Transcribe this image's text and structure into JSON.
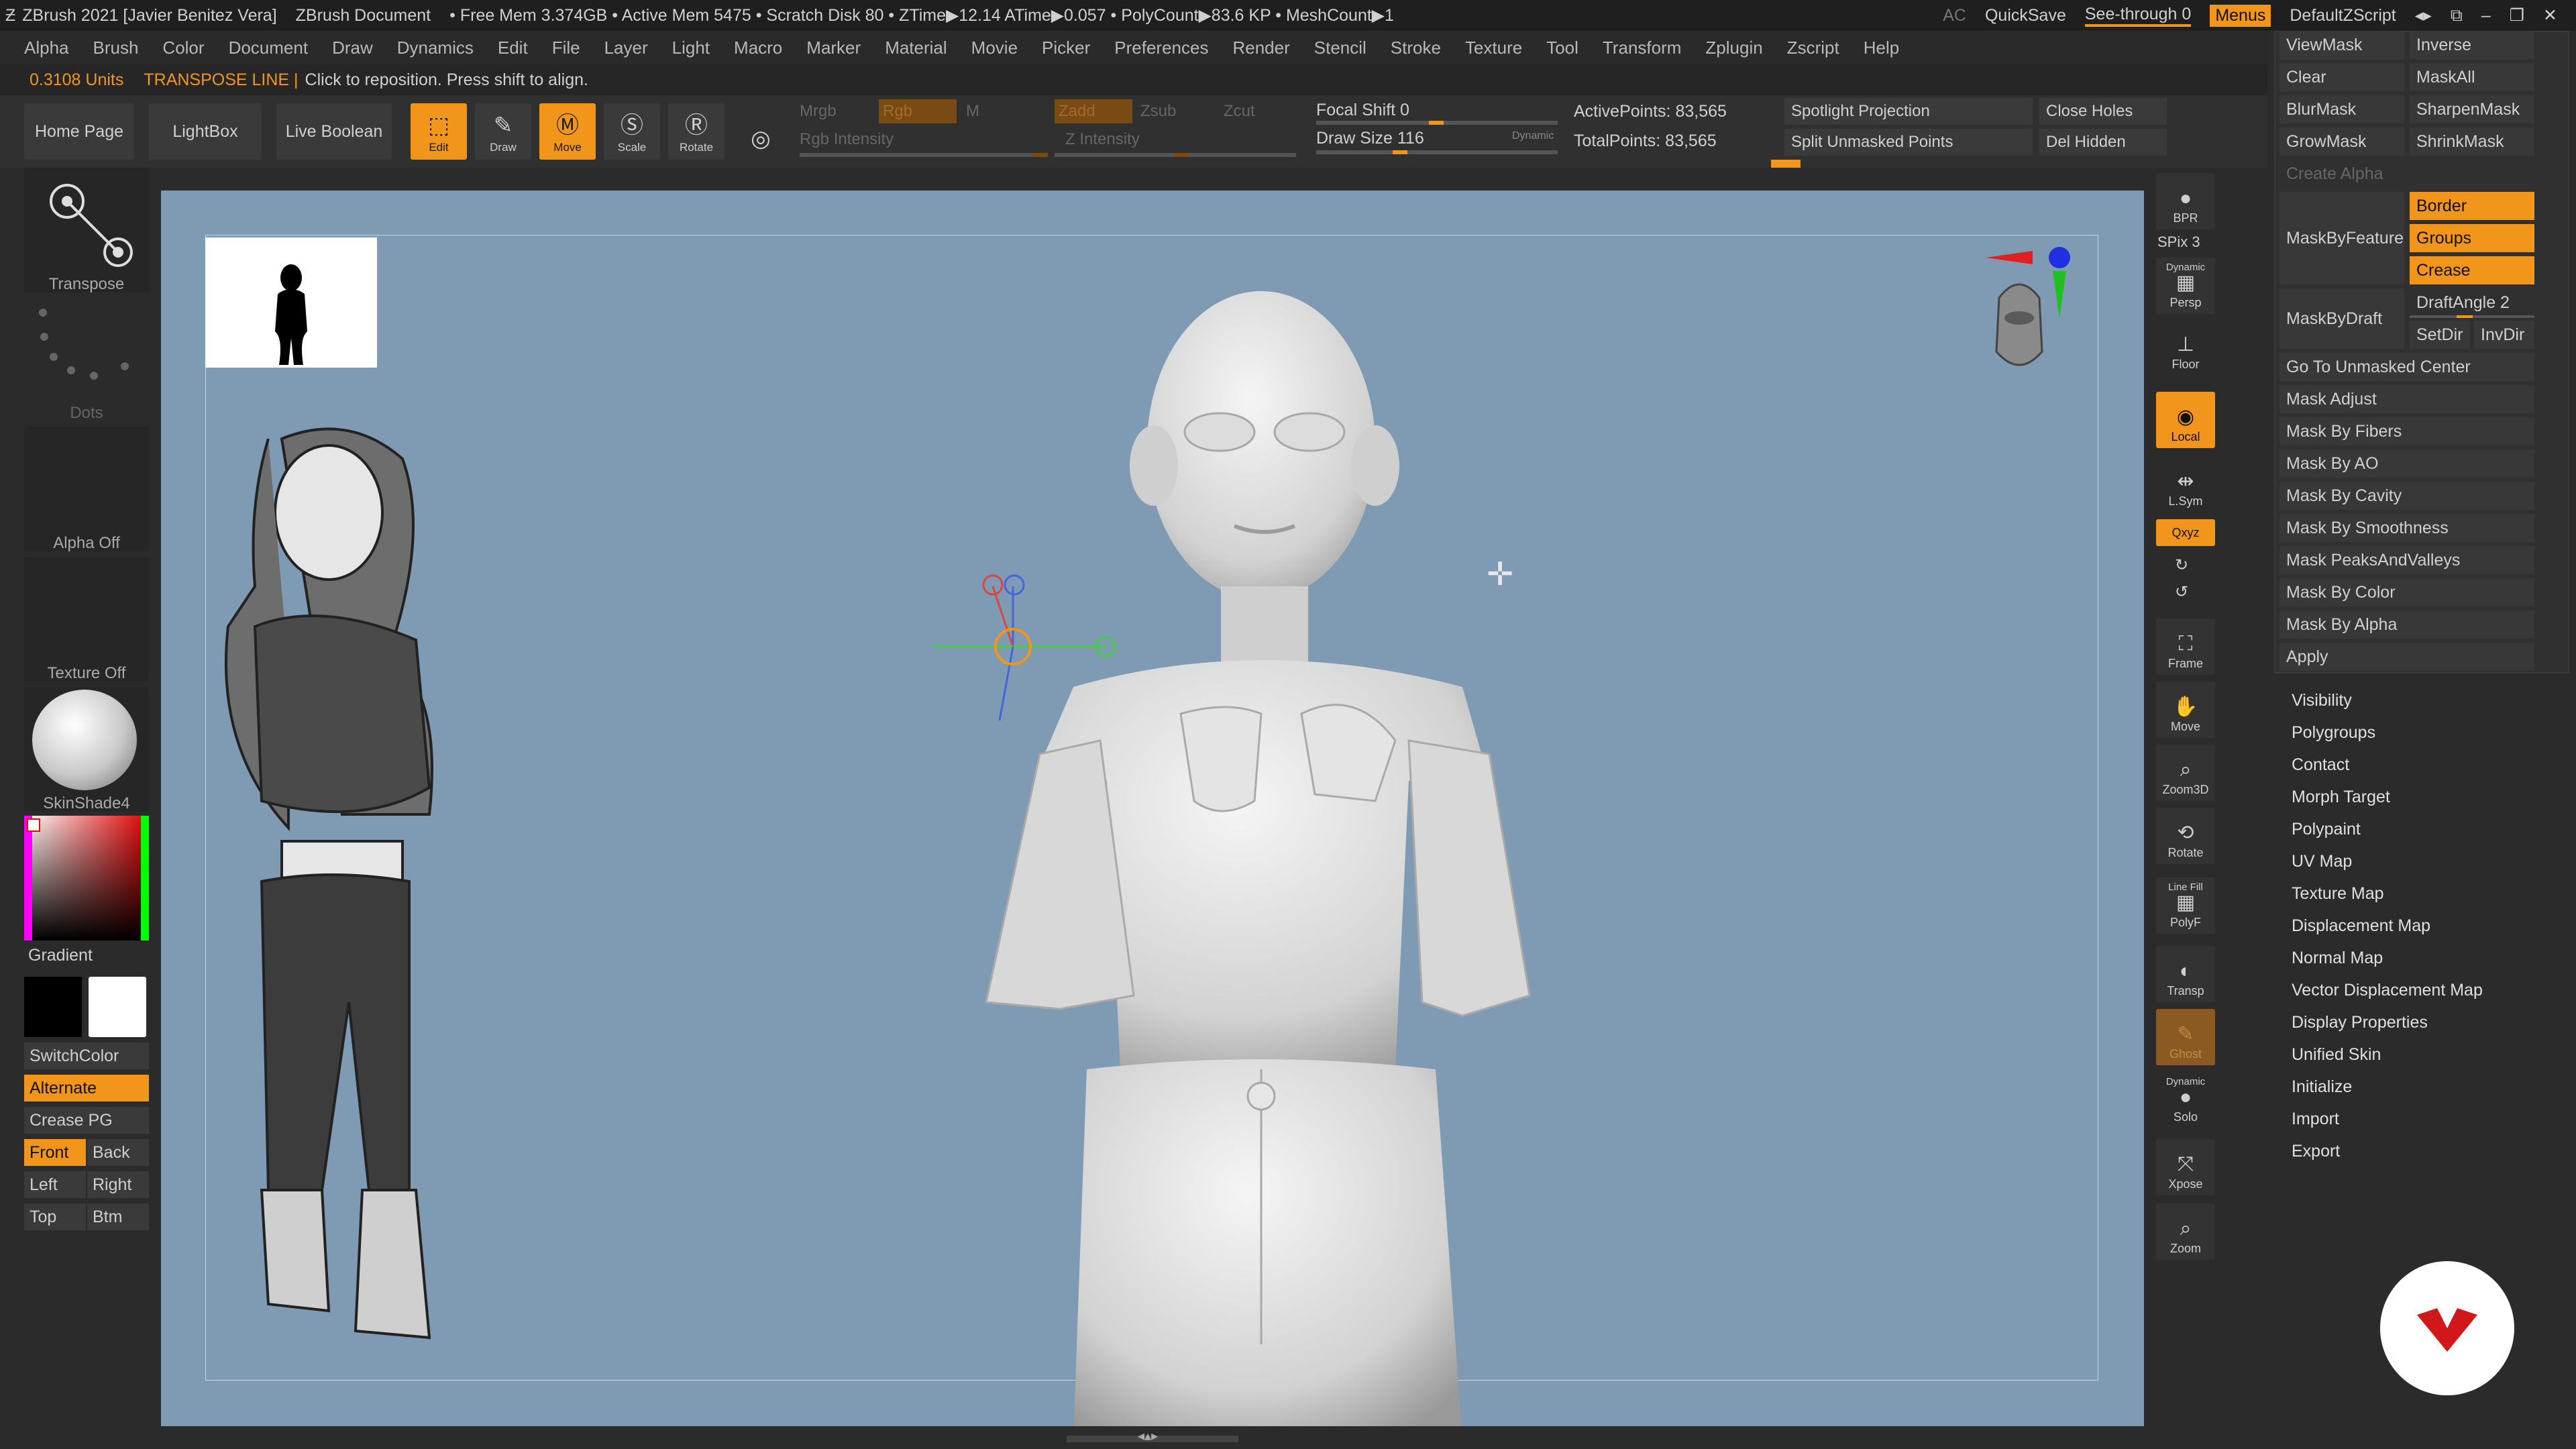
{
  "titlebar": {
    "app": "ZBrush 2021 [Javier Benitez Vera]",
    "doc": "ZBrush Document",
    "stats": "• Free Mem 3.374GB • Active Mem 5475 • Scratch Disk 80 • ZTime▶12.14 ATime▶0.057 • PolyCount▶83.6 KP • MeshCount▶1",
    "ac": "AC",
    "quicksave": "QuickSave",
    "seethrough": "See-through  0",
    "menus": "Menus",
    "script": "DefaultZScript"
  },
  "menubar": [
    "Alpha",
    "Brush",
    "Color",
    "Document",
    "Draw",
    "Dynamics",
    "Edit",
    "File",
    "Layer",
    "Light",
    "Macro",
    "Marker",
    "Material",
    "Movie",
    "Picker",
    "Preferences",
    "Render",
    "Stencil",
    "Stroke",
    "Texture",
    "Tool",
    "Transform",
    "Zplugin",
    "Zscript",
    "Help"
  ],
  "status": {
    "units": "0.3108 Units",
    "mode": "TRANSPOSE LINE |",
    "hint": "Click to reposition. Press shift to align."
  },
  "shelf": {
    "home": "Home Page",
    "lightbox": "LightBox",
    "liveboolean": "Live Boolean",
    "edit": "Edit",
    "draw": "Draw",
    "move": "Move",
    "scale": "Scale",
    "rotate": "Rotate",
    "mrgb": "Mrgb",
    "rgb": "Rgb",
    "m": "M",
    "rgb_intensity": "Rgb Intensity",
    "zadd": "Zadd",
    "zsub": "Zsub",
    "zcut": "Zcut",
    "z_intensity": "Z Intensity",
    "focal_shift": "Focal Shift 0",
    "draw_size": "Draw Size 116",
    "dynamic": "Dynamic",
    "active_points": "ActivePoints: 83,565",
    "total_points": "TotalPoints: 83,565",
    "spotlight": "Spotlight Projection",
    "split_unmasked": "Split Unmasked Points",
    "close_holes": "Close Holes",
    "del_hidden": "Del Hidden"
  },
  "lefttray": {
    "transpose": "Transpose",
    "dots": "Dots",
    "alpha": "Alpha Off",
    "texture": "Texture Off",
    "material": "SkinShade4",
    "gradient": "Gradient",
    "switchcolor": "SwitchColor",
    "alternate": "Alternate",
    "creasepg": "Crease PG",
    "front": "Front",
    "back": "Back",
    "left": "Left",
    "right": "Right",
    "top": "Top",
    "btm": "Btm"
  },
  "rightnav": {
    "bpr": "BPR",
    "spix": "SPix 3",
    "dynamic": "Dynamic",
    "persp": "Persp",
    "floor": "Floor",
    "local": "Local",
    "lsym": "L.Sym",
    "xyz": "Qxyz",
    "frame": "Frame",
    "move": "Move",
    "zoom3d": "Zoom3D",
    "rotate": "Rotate",
    "linefill": "Line Fill",
    "polyf": "PolyF",
    "transp": "Transp",
    "ghost": "Ghost",
    "dynamic2": "Dynamic",
    "solo": "Solo",
    "xpose": "Xpose",
    "zoom": "Zoom"
  },
  "masking": {
    "viewmask": "ViewMask",
    "inverse": "Inverse",
    "clear": "Clear",
    "maskall": "MaskAll",
    "blurmask": "BlurMask",
    "sharpenmask": "SharpenMask",
    "growmask": "GrowMask",
    "shrinkmask": "ShrinkMask",
    "createalpha": "Create Alpha",
    "maskbyfeature": "MaskByFeature",
    "border": "Border",
    "groups": "Groups",
    "crease": "Crease",
    "maskbydraft": "MaskByDraft",
    "draftangle": "DraftAngle 2",
    "setdir": "SetDir",
    "invdir": "InvDir",
    "gotounmasked": "Go To Unmasked Center",
    "items": [
      "Mask Adjust",
      "Mask By Fibers",
      "Mask By AO",
      "Mask By Cavity",
      "Mask By Smoothness",
      "Mask PeaksAndValleys",
      "Mask By Color",
      "Mask By Alpha",
      "Apply"
    ]
  },
  "subpalettes": [
    "Visibility",
    "Polygroups",
    "Contact",
    "Morph Target",
    "Polypaint",
    "UV Map",
    "Texture Map",
    "Displacement Map",
    "Normal Map",
    "Vector Displacement Map",
    "Display Properties",
    "Unified Skin",
    "Initialize",
    "Import",
    "Export"
  ],
  "colors": {
    "accent": "#f2951b",
    "canvas": "#7f9ab3",
    "bg": "#2b2b2b"
  }
}
